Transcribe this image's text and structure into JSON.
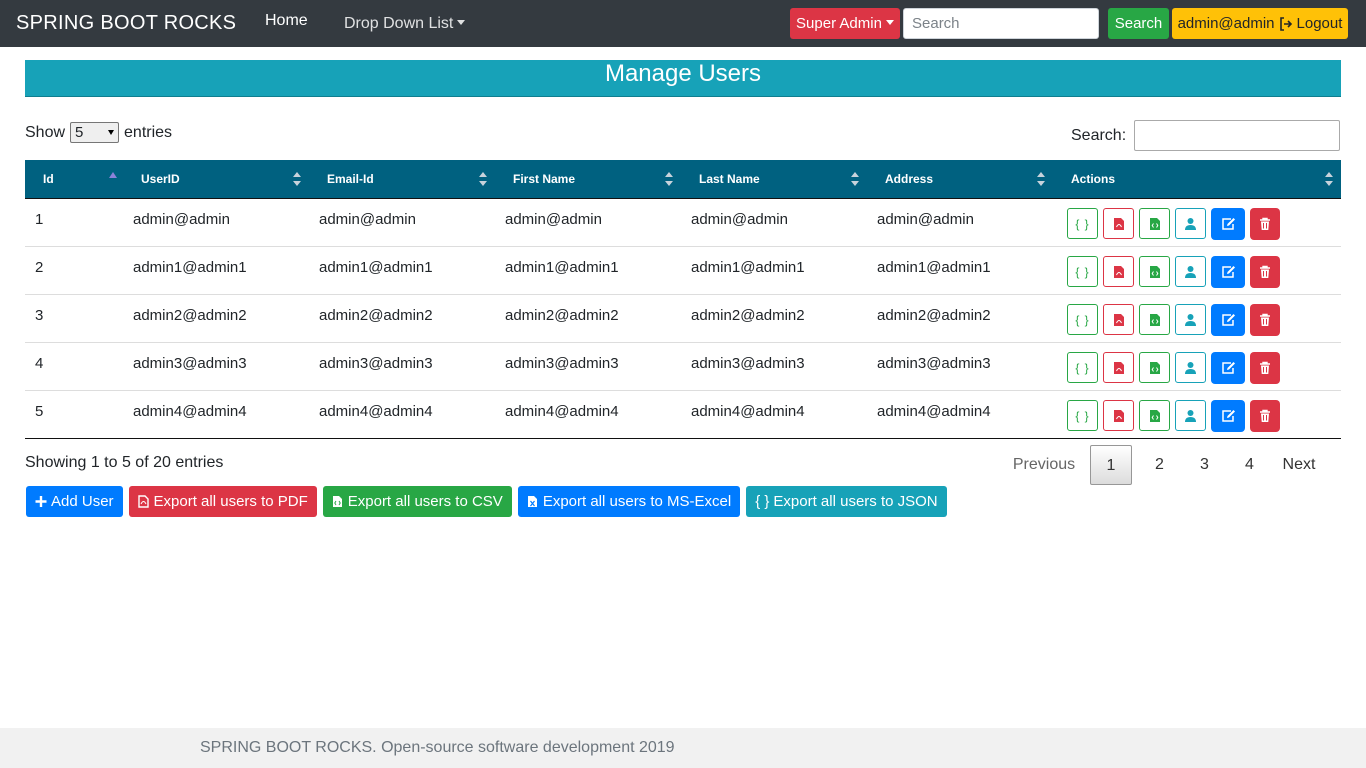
{
  "navbar": {
    "brand": "SPRING BOOT ROCKS",
    "home": "Home",
    "dropdown": "Drop Down List",
    "role_button": "Super Admin",
    "search_placeholder": "Search",
    "search_button": "Search",
    "user": "admin@admin",
    "logout": "Logout"
  },
  "page_title": "Manage Users",
  "length_control": {
    "prefix": "Show",
    "value": "5",
    "suffix": "entries"
  },
  "search_label": "Search:",
  "table": {
    "columns": [
      "Id",
      "UserID",
      "Email-Id",
      "First Name",
      "Last Name",
      "Address",
      "Actions"
    ],
    "rows": [
      [
        "1",
        "admin@admin",
        "admin@admin",
        "admin@admin",
        "admin@admin",
        "admin@admin"
      ],
      [
        "2",
        "admin1@admin1",
        "admin1@admin1",
        "admin1@admin1",
        "admin1@admin1",
        "admin1@admin1"
      ],
      [
        "3",
        "admin2@admin2",
        "admin2@admin2",
        "admin2@admin2",
        "admin2@admin2",
        "admin2@admin2"
      ],
      [
        "4",
        "admin3@admin3",
        "admin3@admin3",
        "admin3@admin3",
        "admin3@admin3",
        "admin3@admin3"
      ],
      [
        "5",
        "admin4@admin4",
        "admin4@admin4",
        "admin4@admin4",
        "admin4@admin4",
        "admin4@admin4"
      ]
    ],
    "row_actions": [
      "json-icon",
      "pdf-icon",
      "csv-file-icon",
      "user-icon",
      "edit-icon",
      "trash-icon"
    ],
    "json_glyph": "{ }"
  },
  "info": "Showing 1 to 5 of 20 entries",
  "pagination": {
    "previous": "Previous",
    "pages": [
      "1",
      "2",
      "3",
      "4"
    ],
    "current": "1",
    "next": "Next"
  },
  "exports": {
    "add_user": "Add User",
    "pdf": "Export all users to PDF",
    "csv": "Export all users to CSV",
    "excel": "Export all users to MS-Excel",
    "json": "Export all users to JSON",
    "json_glyph": "{ }"
  },
  "footer": "SPRING BOOT ROCKS. Open-source software development 2019",
  "colors": {
    "navbar": "#343a40",
    "title_banner": "#17a2b8",
    "table_header": "#006180",
    "primary": "#007bff",
    "danger": "#dc3545",
    "success": "#28a745",
    "warning": "#ffc107",
    "info": "#17a2b8"
  }
}
